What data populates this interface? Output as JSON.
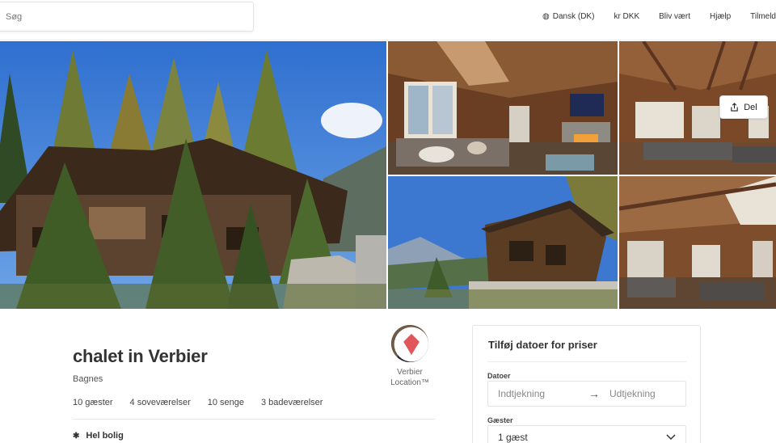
{
  "header": {
    "search_placeholder": "Søg",
    "nav": {
      "language": "Dansk (DK)",
      "currency": "kr DKK",
      "host": "Bliv vært",
      "help": "Hjælp",
      "signup": "Tilmeld"
    }
  },
  "gallery": {
    "share_label": "Del",
    "icons": [
      "share-icon"
    ]
  },
  "listing": {
    "title": "chalet in Verbier",
    "location": "Bagnes",
    "facts": [
      "10 gæster",
      "4 soveværelser",
      "10 senge",
      "3 badeværelser"
    ],
    "feature": "Hel bolig",
    "host": {
      "name_line1": "Verbier",
      "name_line2": "Location™"
    }
  },
  "booking": {
    "title": "Tilføj datoer for priser",
    "dates_label": "Datoer",
    "checkin_placeholder": "Indtjekning",
    "checkout_placeholder": "Udtjekning",
    "guests_label": "Gæster",
    "guests_value": "1 gæst"
  },
  "colors": {
    "text": "#222222",
    "muted": "#555555",
    "border": "#e4e4e4",
    "sky": "#3d7fd0",
    "wood": "#7a4a2a"
  }
}
